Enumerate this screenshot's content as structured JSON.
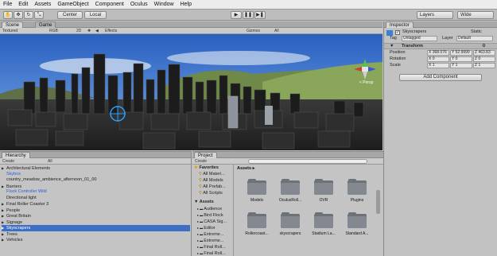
{
  "menu": [
    "File",
    "Edit",
    "Assets",
    "GameObject",
    "Component",
    "Oculus",
    "Window",
    "Help"
  ],
  "toolbar": {
    "pivot": "Center",
    "space": "Local",
    "layers": "Layers",
    "layout": "Wide"
  },
  "scene": {
    "tab_scene": "Scene",
    "tab_game": "Game",
    "shading": "Textured",
    "render": "RGB",
    "mode_2d": "2D",
    "effects": "Effects",
    "gizmos": "Gizmos",
    "search_all": "All",
    "persp": "< Persp"
  },
  "hierarchy": {
    "title": "Hierarchy",
    "create": "Create",
    "search_all": "All",
    "items": [
      {
        "label": "Architectural Elements",
        "arrow": "▶",
        "blue": false,
        "selected": false
      },
      {
        "label": "Skybox",
        "arrow": "",
        "blue": true,
        "selected": false
      },
      {
        "label": "country_meadow_ambience_afternoon_01_00",
        "arrow": "",
        "blue": false,
        "selected": false
      },
      {
        "label": "Barriers",
        "arrow": "▶",
        "blue": false,
        "selected": false
      },
      {
        "label": "Flock Controller Wild",
        "arrow": "",
        "blue": true,
        "selected": false
      },
      {
        "label": "Directional light",
        "arrow": "",
        "blue": false,
        "selected": false
      },
      {
        "label": "Final Roller Coaster 3",
        "arrow": "▶",
        "blue": false,
        "selected": false
      },
      {
        "label": "People",
        "arrow": "▶",
        "blue": false,
        "selected": false
      },
      {
        "label": "Great Britain",
        "arrow": "▶",
        "blue": false,
        "selected": false
      },
      {
        "label": "Signage",
        "arrow": "▶",
        "blue": false,
        "selected": false
      },
      {
        "label": "Skyscrapers",
        "arrow": "▶",
        "blue": false,
        "selected": true
      },
      {
        "label": "Trees",
        "arrow": "▶",
        "blue": false,
        "selected": false
      },
      {
        "label": "Vehicles",
        "arrow": "▶",
        "blue": false,
        "selected": false
      }
    ]
  },
  "project": {
    "title": "Project",
    "create": "Create",
    "favorites_label": "Favorites",
    "favorites": [
      "All Materi...",
      "All Models",
      "All Prefab...",
      "All Scripts"
    ],
    "assets_label": "Assets",
    "assets_tree": [
      "Audience",
      "Bird Flock",
      "CASA Sig...",
      "Editor",
      "Extreme...",
      "Extreme...",
      "Final Roll...",
      "Final Roll..."
    ],
    "breadcrumb": "Assets ▸",
    "folders": [
      "Models",
      "OculusRoll...",
      "OVR",
      "Plugins",
      "Rollercoast...",
      "skyscrapers",
      "Stadium La...",
      "Standard A..."
    ]
  },
  "inspector": {
    "title": "Inspector",
    "object_name": "Skyscrapers",
    "static_label": "Static",
    "tag_label": "Tag",
    "tag_value": "Untagged",
    "layer_label": "Layer",
    "layer_value": "Default",
    "transform_label": "Transform",
    "position_label": "Position",
    "rotation_label": "Rotation",
    "scale_label": "Scale",
    "position": {
      "x": "X 368.076",
      "y": "Y 52.9999",
      "z": "Z 463.83"
    },
    "rotation": {
      "x": "X 0",
      "y": "Y 0",
      "z": "Z 0"
    },
    "scale": {
      "x": "X 1",
      "y": "Y 1",
      "z": "Z 1"
    },
    "add_component": "Add Component"
  }
}
